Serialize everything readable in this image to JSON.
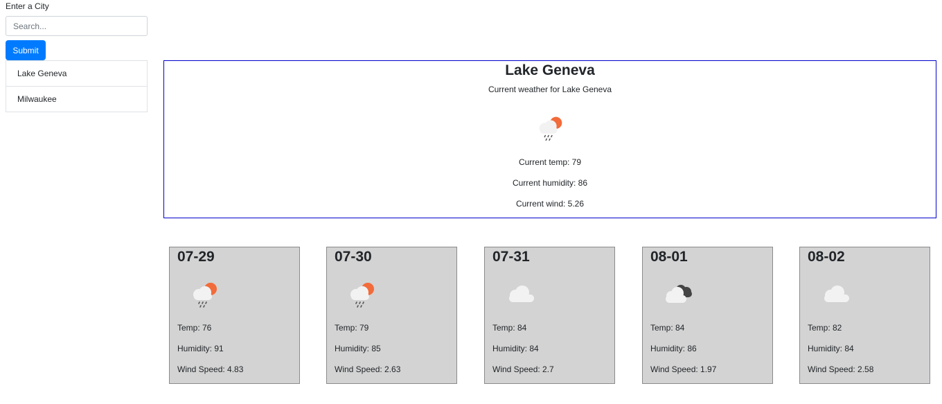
{
  "search": {
    "label": "Enter a City",
    "placeholder": "Search...",
    "value": "",
    "submit_label": "Submit"
  },
  "history": [
    {
      "label": "Lake Geneva"
    },
    {
      "label": "Milwaukee"
    }
  ],
  "current": {
    "title": "Lake Geneva",
    "subtitle": "Current weather for Lake Geneva",
    "icon": "rain-sun-icon",
    "temp": "Current temp: 79",
    "humidity": "Current humidity: 86",
    "wind": "Current wind: 5.26"
  },
  "forecast": [
    {
      "date": "07-29",
      "icon": "rain-sun-icon",
      "temp": "Temp: 76",
      "humidity": "Humidity: 91",
      "wind": "Wind Speed: 4.83"
    },
    {
      "date": "07-30",
      "icon": "rain-sun-icon",
      "temp": "Temp: 79",
      "humidity": "Humidity: 85",
      "wind": "Wind Speed: 2.63"
    },
    {
      "date": "07-31",
      "icon": "cloud-icon",
      "temp": "Temp: 84",
      "humidity": "Humidity: 84",
      "wind": "Wind Speed: 2.7"
    },
    {
      "date": "08-01",
      "icon": "broken-clouds-icon",
      "temp": "Temp: 84",
      "humidity": "Humidity: 86",
      "wind": "Wind Speed: 1.97"
    },
    {
      "date": "08-02",
      "icon": "cloud-icon",
      "temp": "Temp: 82",
      "humidity": "Humidity: 84",
      "wind": "Wind Speed: 2.58"
    }
  ],
  "colors": {
    "accent": "#007bff",
    "current_border": "#0000cc",
    "card_bg": "#d3d3d3",
    "sun": "#f26b3a"
  }
}
